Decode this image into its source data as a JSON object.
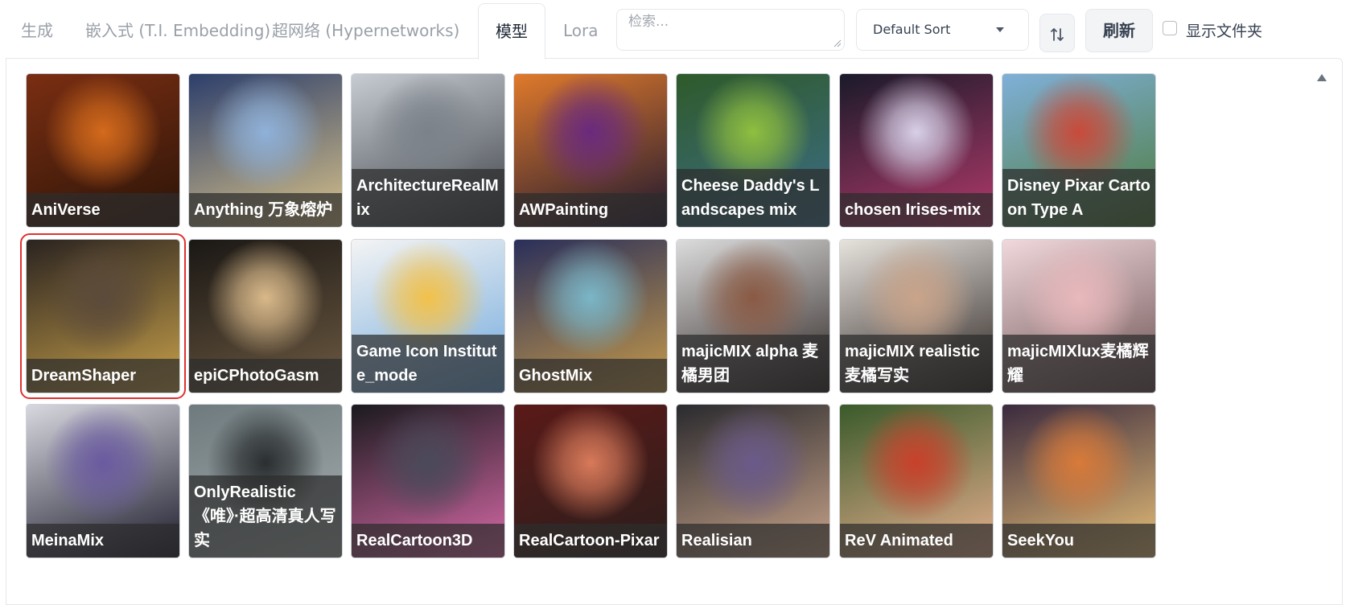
{
  "tabs": [
    {
      "label": "生成",
      "active": false
    },
    {
      "label": "嵌入式 (T.I. Embedding)",
      "active": false
    },
    {
      "label": "超网络 (Hypernetworks)",
      "active": false
    },
    {
      "label": "模型",
      "active": true
    },
    {
      "label": "Lora",
      "active": false
    }
  ],
  "search": {
    "placeholder": "检索...",
    "value": ""
  },
  "sort": {
    "selected": "Default Sort",
    "direction_icon": "sort-up-down-icon"
  },
  "refresh_label": "刷新",
  "show_folders": {
    "label": "显示文件夹",
    "checked": false
  },
  "gallery": {
    "selected_index": 7,
    "cards": [
      {
        "name": "AniVerse",
        "colors": [
          "#7a2e12",
          "#d46a1c",
          "#2b1408"
        ]
      },
      {
        "name": "Anything 万象熔炉",
        "colors": [
          "#2c3e6b",
          "#8fb1d9",
          "#d9c38a"
        ]
      },
      {
        "name": "ArchitectureRealMix",
        "colors": [
          "#c7ccd3",
          "#7b8289",
          "#3b3f44"
        ]
      },
      {
        "name": "AWPainting",
        "colors": [
          "#e07a2c",
          "#6a2a7e",
          "#1d1730"
        ]
      },
      {
        "name": "Cheese Daddy's Landscapes mix",
        "colors": [
          "#2f5a2a",
          "#8fbf3f",
          "#3c6e8a"
        ]
      },
      {
        "name": "chosen Irises-mix",
        "colors": [
          "#1a1a2a",
          "#d8d0e8",
          "#b33a6b"
        ]
      },
      {
        "name": "Disney Pixar Cartoon Type A",
        "colors": [
          "#7fb0d8",
          "#c94a3a",
          "#4d7a3a"
        ]
      },
      {
        "name": "DreamShaper",
        "colors": [
          "#2a2320",
          "#5b4a3a",
          "#c8a14a"
        ]
      },
      {
        "name": "epiCPhotoGasm",
        "colors": [
          "#1a1714",
          "#d9b98a",
          "#6d5a42"
        ]
      },
      {
        "name": "Game Icon Institute_mode",
        "colors": [
          "#f4f4f4",
          "#f2c14a",
          "#6fa8dc"
        ]
      },
      {
        "name": "GhostMix",
        "colors": [
          "#2a2f5a",
          "#7ab6c8",
          "#c79b4a"
        ]
      },
      {
        "name": "majicMIX alpha 麦橘男团",
        "colors": [
          "#dcdcdc",
          "#8a5a44",
          "#2a2220"
        ]
      },
      {
        "name": "majicMIX realistic 麦橘写实",
        "colors": [
          "#e6e2dc",
          "#c9a48a",
          "#2a2220"
        ]
      },
      {
        "name": "majicMIXlux麦橘辉耀",
        "colors": [
          "#f0d8dc",
          "#e8b8bc",
          "#6b5050"
        ]
      },
      {
        "name": "MeinaMix",
        "colors": [
          "#d8d8e0",
          "#6a5aa0",
          "#1a1a2a"
        ]
      },
      {
        "name": "OnlyRealistic 《唯》·超高清真人写实",
        "colors": [
          "#6e7a7e",
          "#2a2e30",
          "#a8b0b0"
        ]
      },
      {
        "name": "RealCartoon3D",
        "colors": [
          "#1a1a1e",
          "#4a4a5a",
          "#d86aa8"
        ]
      },
      {
        "name": "RealCartoon-Pixar",
        "colors": [
          "#5a1a18",
          "#d87a5a",
          "#2a1e1c"
        ]
      },
      {
        "name": "Realisian",
        "colors": [
          "#2a2a2e",
          "#6a5a8a",
          "#c9a48a"
        ]
      },
      {
        "name": "ReV Animated",
        "colors": [
          "#3a5a2a",
          "#c9402a",
          "#e8b090"
        ]
      },
      {
        "name": "SeekYou",
        "colors": [
          "#3a2a3e",
          "#d87a3a",
          "#e8c078"
        ]
      }
    ]
  }
}
